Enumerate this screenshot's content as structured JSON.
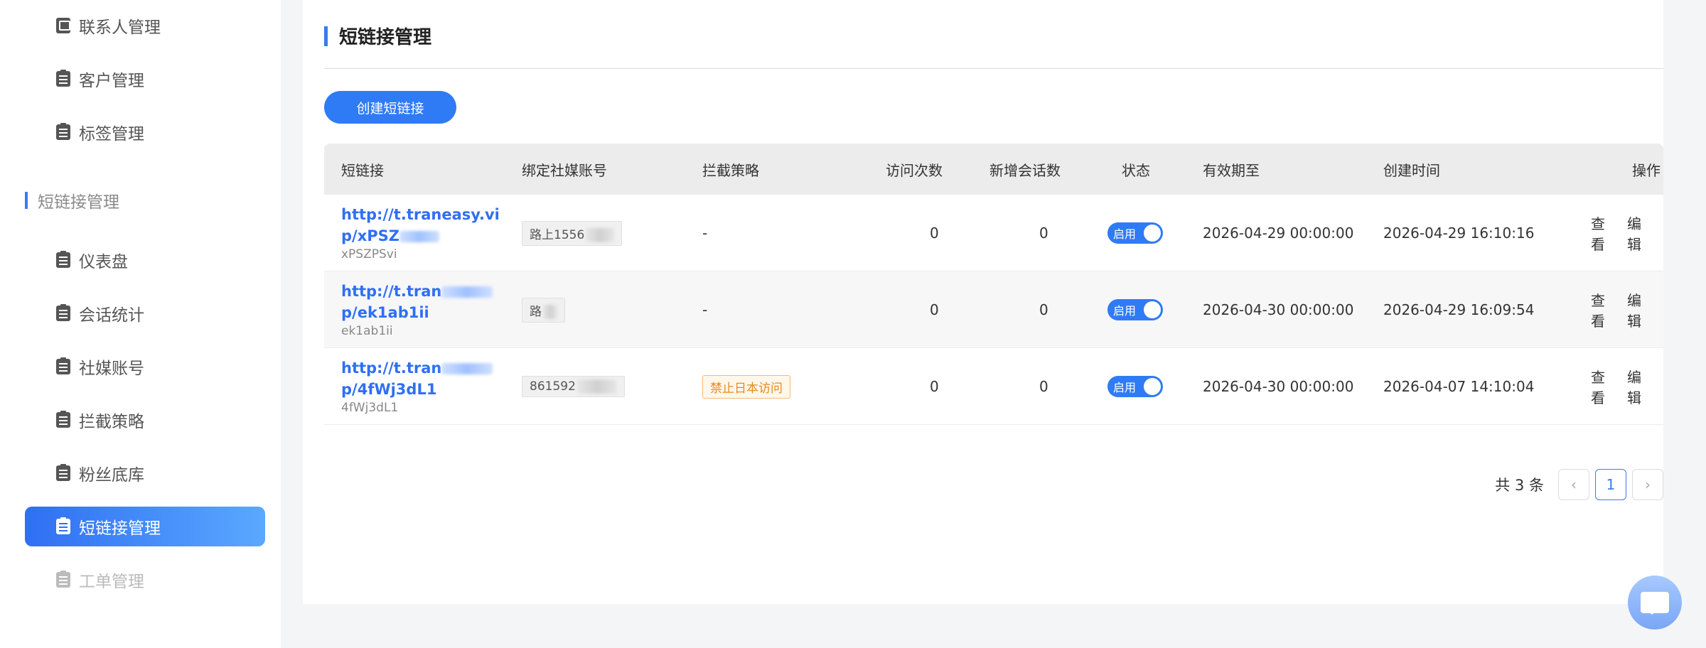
{
  "sidebar": {
    "items_top": [
      {
        "label": "联系人管理",
        "icon": "contact-card-icon"
      },
      {
        "label": "客户管理",
        "icon": "document-icon"
      },
      {
        "label": "标签管理",
        "icon": "document-icon"
      }
    ],
    "section": {
      "label": "短链接管理"
    },
    "items": [
      {
        "label": "仪表盘",
        "icon": "document-icon"
      },
      {
        "label": "会话统计",
        "icon": "document-icon"
      },
      {
        "label": "社媒账号",
        "icon": "document-icon"
      },
      {
        "label": "拦截策略",
        "icon": "document-icon"
      },
      {
        "label": "粉丝底库",
        "icon": "document-icon"
      },
      {
        "label": "短链接管理",
        "icon": "document-icon",
        "active": true
      },
      {
        "label": "工单管理",
        "icon": "document-icon"
      }
    ]
  },
  "main": {
    "title": "短链接管理",
    "create_button": "创建短链接",
    "columns": [
      "短链接",
      "绑定社媒账号",
      "拦截策略",
      "访问次数",
      "新增会话数",
      "状态",
      "有效期至",
      "创建时间",
      "操作"
    ],
    "rows": [
      {
        "link_line1": "http://t.traneasy.vi",
        "link_line2": "p/xPSZ",
        "code": "xPSZPSvi",
        "account": "路上1556",
        "strategy": "-",
        "visits": "0",
        "sessions": "0",
        "status": "启用",
        "expires": "2026-04-29 00:00:00",
        "created": "2026-04-29 16:10:16",
        "op_view": "查看",
        "op_edit": "编辑"
      },
      {
        "link_line1": "http://t.tran",
        "link_line2": "p/ek1ab1ii",
        "code": "ek1ab1ii",
        "account": "路",
        "strategy": "-",
        "visits": "0",
        "sessions": "0",
        "status": "启用",
        "expires": "2026-04-30 00:00:00",
        "created": "2026-04-29 16:09:54",
        "op_view": "查看",
        "op_edit": "编辑"
      },
      {
        "link_line1": "http://t.tran",
        "link_line2": "p/4fWj3dL1",
        "code": "4fWj3dL1",
        "account": "861592",
        "strategy": "禁止日本访问",
        "visits": "0",
        "sessions": "0",
        "status": "启用",
        "expires": "2026-04-30 00:00:00",
        "created": "2026-04-07 14:10:04",
        "op_view": "查看",
        "op_edit": "编辑"
      }
    ],
    "pagination": {
      "total": "共 3 条",
      "current": "1",
      "prev": "‹",
      "next": "›"
    }
  },
  "colors": {
    "accent": "#2f7bf6",
    "tag_text": "#e88a1a"
  }
}
